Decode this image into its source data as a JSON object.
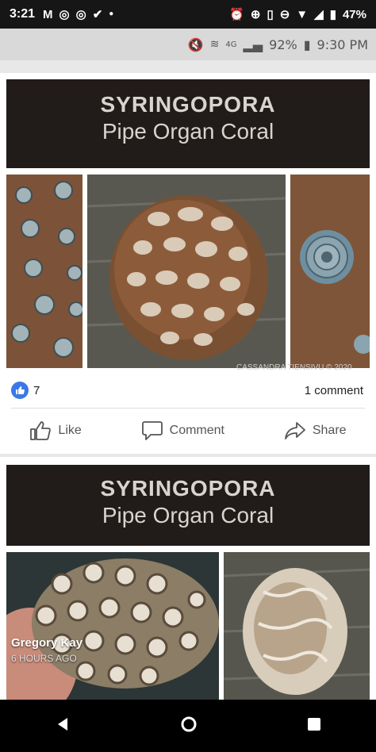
{
  "status_bar": {
    "time": "3:21",
    "battery": "47%",
    "left_icons": [
      "gmail-icon",
      "instagram-icon",
      "instagram-icon",
      "check-icon",
      "dot-icon"
    ],
    "right_icons": [
      "alarm-icon",
      "data-saver-icon",
      "vibrate-icon",
      "dnd-icon",
      "wifi-icon",
      "signal-icon",
      "battery-icon"
    ]
  },
  "inner_status": {
    "network": "4G",
    "battery": "92%",
    "time": "9:30 PM"
  },
  "posts": [
    {
      "banner_line1": "SYRINGOPORA",
      "banner_line2": "Pipe Organ Coral",
      "credit": "CASSANDRA TIENSIVU © 2020",
      "reactions": {
        "likes": "7",
        "comments": "1 comment"
      },
      "actions": {
        "like": "Like",
        "comment": "Comment",
        "share": "Share"
      }
    },
    {
      "banner_line1": "SYRINGOPORA",
      "banner_line2": "Pipe Organ Coral",
      "author": "Gregory Kay",
      "posted": "6 HOURS AGO"
    }
  ],
  "colors": {
    "accent_like": "#3b78e7",
    "banner_bg": "#211b19",
    "status_bar": "#161616"
  }
}
